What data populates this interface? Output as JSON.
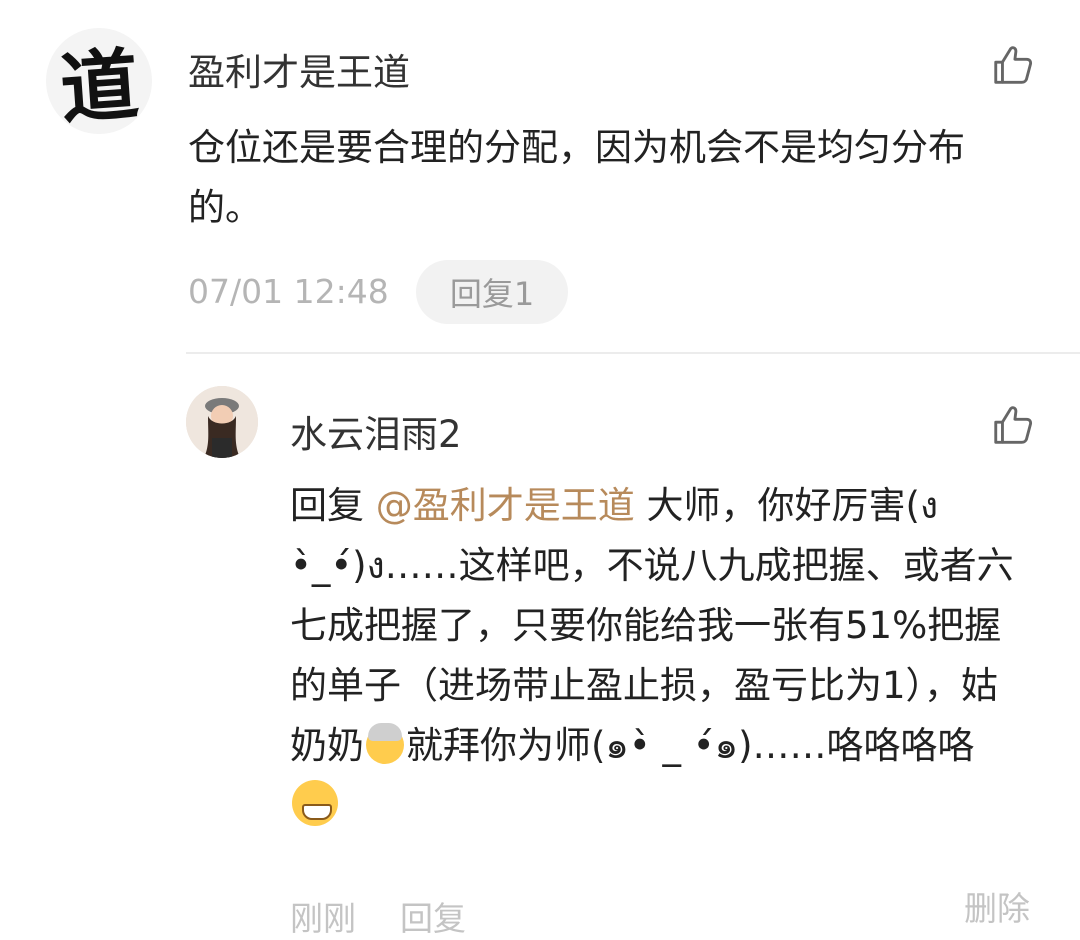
{
  "comment": {
    "avatar_text": "道",
    "username": "盈利才是王道",
    "content": "仓位还是要合理的分配，因为机会不是均匀分布的。",
    "timestamp": "07/01 12:48",
    "reply_button": "回复1"
  },
  "reply": {
    "username": "水云泪雨2",
    "prefix": "回复 ",
    "mention": "@盈利才是王道",
    "text_1": " 大师，你好厉害(ง •̀_•́)ง……这样吧，不说八九成把握、或者六七成把握了，只要你能给我一张有51%把握的单子（进场带止盈止损，盈亏比为1），姑奶奶",
    "text_2": "就拜你为师(๑•̀ _ •́๑)……咯咯咯咯",
    "timestamp": "刚刚",
    "reply_button": "回复",
    "delete_button": "删除"
  },
  "icons": {
    "like": "thumbs-up-icon",
    "grandma_emoji": "older-woman-emoji",
    "grin_emoji": "grinning-face-emoji"
  },
  "colors": {
    "mention": "#b78a5b",
    "meta": "#b5b5b5",
    "pill_bg": "#f2f2f2"
  }
}
